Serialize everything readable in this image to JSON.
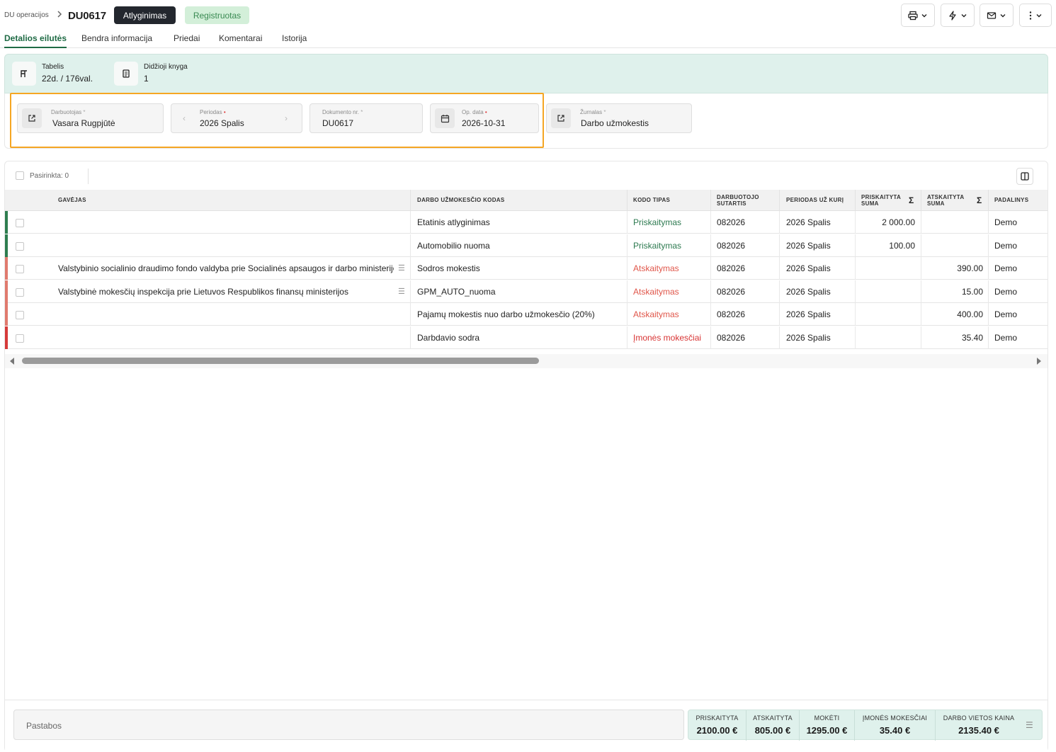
{
  "header": {
    "breadcrumb": "DU operacijos",
    "doc_title": "DU0617",
    "type_badge": "Atlyginimas",
    "status_badge": "Registruotas"
  },
  "toolbar": {
    "buttons": [
      {
        "icon": "printer-icon"
      },
      {
        "icon": "lightning-icon"
      },
      {
        "icon": "envelope-icon"
      },
      {
        "icon": "more-vertical-icon"
      }
    ]
  },
  "tabs": [
    {
      "label": "Detalios eilutės",
      "active": true
    },
    {
      "label": "Bendra informacija",
      "active": false
    },
    {
      "label": "Priedai",
      "active": false
    },
    {
      "label": "Komentarai",
      "active": false
    },
    {
      "label": "Istorija",
      "active": false
    }
  ],
  "info": {
    "tabelis": {
      "label": "Tabelis",
      "value": "22d. / 176val."
    },
    "knyga": {
      "label": "Didžioji knyga",
      "value": "1"
    }
  },
  "fields": {
    "darbuotojas": {
      "label": "Darbuotojas",
      "value": "Vasara Rugpjūtė"
    },
    "periodas": {
      "label": "Periodas",
      "value": "2026 Spalis"
    },
    "dokumento_nr": {
      "label": "Dokumento nr.",
      "value": "DU0617"
    },
    "op_data": {
      "label": "Op. data",
      "value": "2026-10-31"
    },
    "zurnalas": {
      "label": "Žurnalas",
      "value": "Darbo užmokestis"
    }
  },
  "selection": {
    "text": "Pasirinkta: 0"
  },
  "table": {
    "columns": {
      "gavejas": "GAVĖJAS",
      "kodas": "DARBO UŽMOKESČIO KODAS",
      "tipas": "KODO TIPAS",
      "sutartis_1": "DARBUOTOJO",
      "sutartis_2": "SUTARTIS",
      "periodas": "PERIODAS UŽ KURĮ",
      "prisk_1": "PRISKAITYTA",
      "prisk_2": "SUMA",
      "atsk_1": "ATSKAITYTA",
      "atsk_2": "SUMA",
      "padalinys": "PADALINYS"
    },
    "rows": [
      {
        "gavejas": "",
        "kodas": "Etatinis atlyginimas",
        "tipas": "Priskaitymas",
        "sutartis": "082026",
        "periodas": "2026 Spalis",
        "priskaityta": "2 000.00",
        "atskaityta": "",
        "padalinys": "Demo",
        "mark_color": "#2e7d4f",
        "tipas_color": "#2d7a50"
      },
      {
        "gavejas": "",
        "kodas": "Automobilio nuoma",
        "tipas": "Priskaitymas",
        "sutartis": "082026",
        "periodas": "2026 Spalis",
        "priskaityta": "100.00",
        "atskaityta": "",
        "padalinys": "Demo",
        "mark_color": "#2e7d4f",
        "tipas_color": "#2d7a50"
      },
      {
        "gavejas": "Valstybinio socialinio draudimo fondo valdyba prie Socialinės apsaugos ir darbo ministerijos",
        "kodas": "Sodros mokestis",
        "tipas": "Atskaitymas",
        "sutartis": "082026",
        "periodas": "2026 Spalis",
        "priskaityta": "",
        "atskaityta": "390.00",
        "padalinys": "Demo",
        "mark_color": "#e07a6e",
        "tipas_color": "#e0564a"
      },
      {
        "gavejas": "Valstybinė mokesčių inspekcija prie Lietuvos Respublikos finansų ministerijos",
        "kodas": "GPM_AUTO_nuoma",
        "tipas": "Atskaitymas",
        "sutartis": "082026",
        "periodas": "2026 Spalis",
        "priskaityta": "",
        "atskaityta": "15.00",
        "padalinys": "Demo",
        "mark_color": "#e07a6e",
        "tipas_color": "#e0564a"
      },
      {
        "gavejas": "",
        "kodas": "Pajamų mokestis nuo darbo užmokesčio (20%)",
        "tipas": "Atskaitymas",
        "sutartis": "082026",
        "periodas": "2026 Spalis",
        "priskaityta": "",
        "atskaityta": "400.00",
        "padalinys": "Demo",
        "mark_color": "#e07a6e",
        "tipas_color": "#e0564a"
      },
      {
        "gavejas": "",
        "kodas": "Darbdavio sodra",
        "tipas": "Įmonės mokesčiai",
        "sutartis": "082026",
        "periodas": "2026 Spalis",
        "priskaityta": "",
        "atskaityta": "35.40",
        "padalinys": "Demo",
        "mark_color": "#d63a3a",
        "tipas_color": "#d83434"
      }
    ]
  },
  "footer": {
    "notes_placeholder": "Pastabos",
    "totals": [
      {
        "label": "PRISKAITYTA",
        "value": "2100.00 €"
      },
      {
        "label": "ATSKAITYTA",
        "value": "805.00 €"
      },
      {
        "label": "MOKĖTI",
        "value": "1295.00 €"
      },
      {
        "label": "ĮMONĖS MOKESČIAI",
        "value": "35.40 €"
      },
      {
        "label": "DARBO VIETOS KAINA",
        "value": "2135.40 €"
      }
    ]
  }
}
